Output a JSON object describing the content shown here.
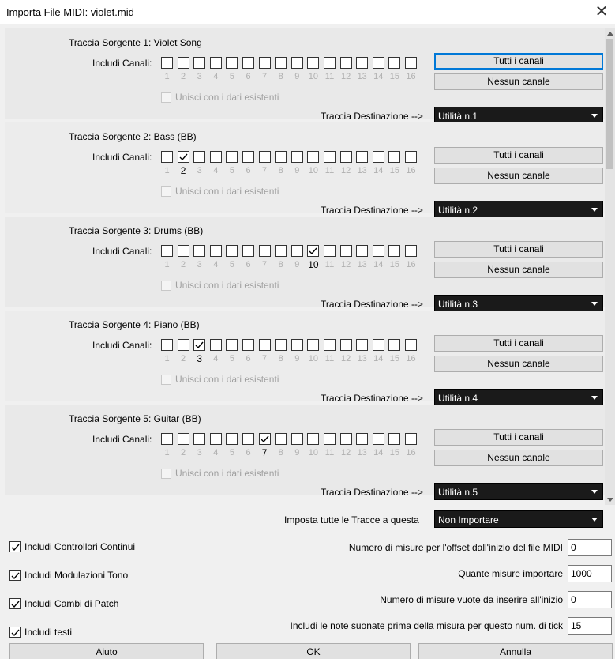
{
  "window": {
    "title": "Importa File MIDI: violet.mid",
    "close_glyph": "✕"
  },
  "labels": {
    "include_channels": "Includi Canali:",
    "merge_existing": "Unisci con i dati esistenti",
    "dest_track": "Traccia Destinazione -->",
    "all_channels": "Tutti i canali",
    "no_channels": "Nessun canale"
  },
  "channel_numbers": [
    "1",
    "2",
    "3",
    "4",
    "5",
    "6",
    "7",
    "8",
    "9",
    "10",
    "11",
    "12",
    "13",
    "14",
    "15",
    "16"
  ],
  "tracks": [
    {
      "title": "Traccia Sorgente 1: Violet Song",
      "checked_channel": null,
      "destination": "Utilità n.1",
      "all_focused": true
    },
    {
      "title": "Traccia Sorgente 2: Bass   (BB)",
      "checked_channel": 2,
      "destination": "Utilità n.2",
      "all_focused": false
    },
    {
      "title": "Traccia Sorgente 3: Drums   (BB)",
      "checked_channel": 10,
      "destination": "Utilità n.3",
      "all_focused": false
    },
    {
      "title": "Traccia Sorgente 4: Piano   (BB)",
      "checked_channel": 3,
      "destination": "Utilità n.4",
      "all_focused": false
    },
    {
      "title": "Traccia Sorgente 5: Guitar   (BB)",
      "checked_channel": 7,
      "destination": "Utilità n.5",
      "all_focused": false
    }
  ],
  "set_all": {
    "label": "Imposta tutte le Tracce a questa",
    "value": "Non Importare"
  },
  "options": [
    {
      "label": "Includi Controllori Continui",
      "checked": true
    },
    {
      "label": "Includi Modulazioni Tono",
      "checked": true
    },
    {
      "label": "Includi Cambi di Patch",
      "checked": true
    },
    {
      "label": "Includi testi",
      "checked": true
    }
  ],
  "fields": [
    {
      "label": "Numero di misure per l'offset dall'inizio del file MIDI",
      "value": "0"
    },
    {
      "label": "Quante misure importare",
      "value": "1000"
    },
    {
      "label": "Numero di misure vuote da inserire all'inizio",
      "value": "0"
    },
    {
      "label": "Includi le note suonate prima della misura per questo num. di tick",
      "value": "15"
    }
  ],
  "buttons": {
    "help": "Aiuto",
    "ok": "OK",
    "cancel": "Annulla"
  },
  "icons": {
    "close": "close-icon",
    "check": "checkmark-icon",
    "dropdown": "chevron-down-icon"
  }
}
